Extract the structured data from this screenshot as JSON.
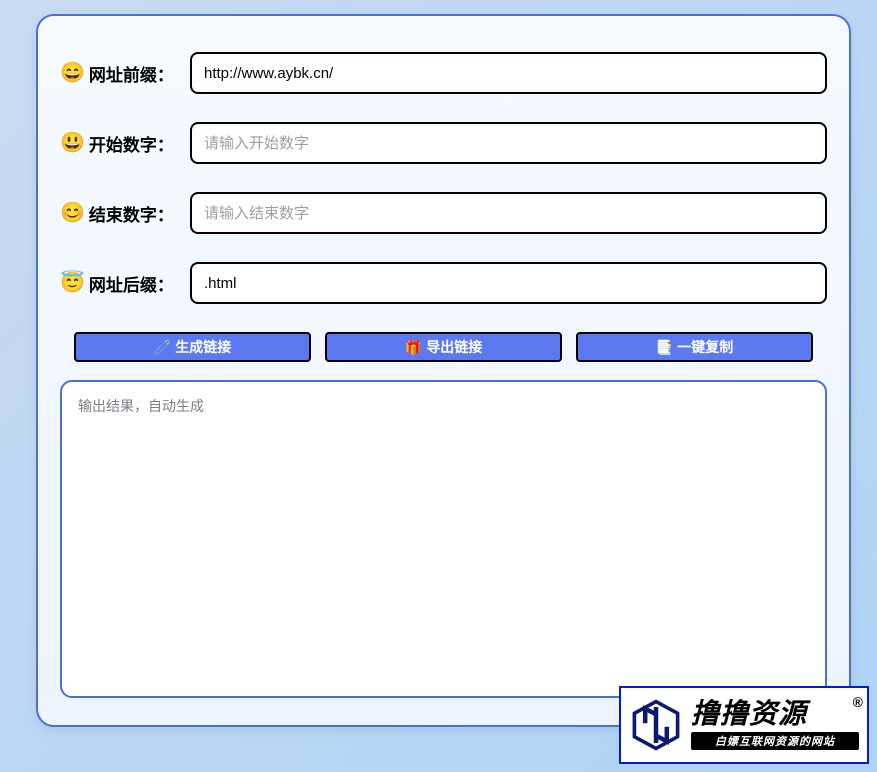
{
  "fields": {
    "url_prefix": {
      "emoji": "😄",
      "label": "网址前缀：",
      "value": "http://www.aybk.cn/",
      "placeholder": ""
    },
    "start_num": {
      "emoji": "😃",
      "label": "开始数字：",
      "value": "",
      "placeholder": "请输入开始数字"
    },
    "end_num": {
      "emoji": "😊",
      "label": "结束数字：",
      "value": "",
      "placeholder": "请输入结束数字"
    },
    "url_suffix": {
      "emoji": "😇",
      "label": "网址后缀：",
      "value": ".html",
      "placeholder": ""
    }
  },
  "buttons": {
    "generate": {
      "emoji": "🧷",
      "label": "生成链接"
    },
    "export": {
      "emoji": "🎁",
      "label": "导出链接"
    },
    "copy": {
      "emoji": "📑",
      "label": "一键复制"
    }
  },
  "output": {
    "placeholder": "输出结果，自动生成"
  },
  "watermark": {
    "main": "撸撸资源",
    "reg": "®",
    "sub": "白嫖互联网资源的网站"
  }
}
